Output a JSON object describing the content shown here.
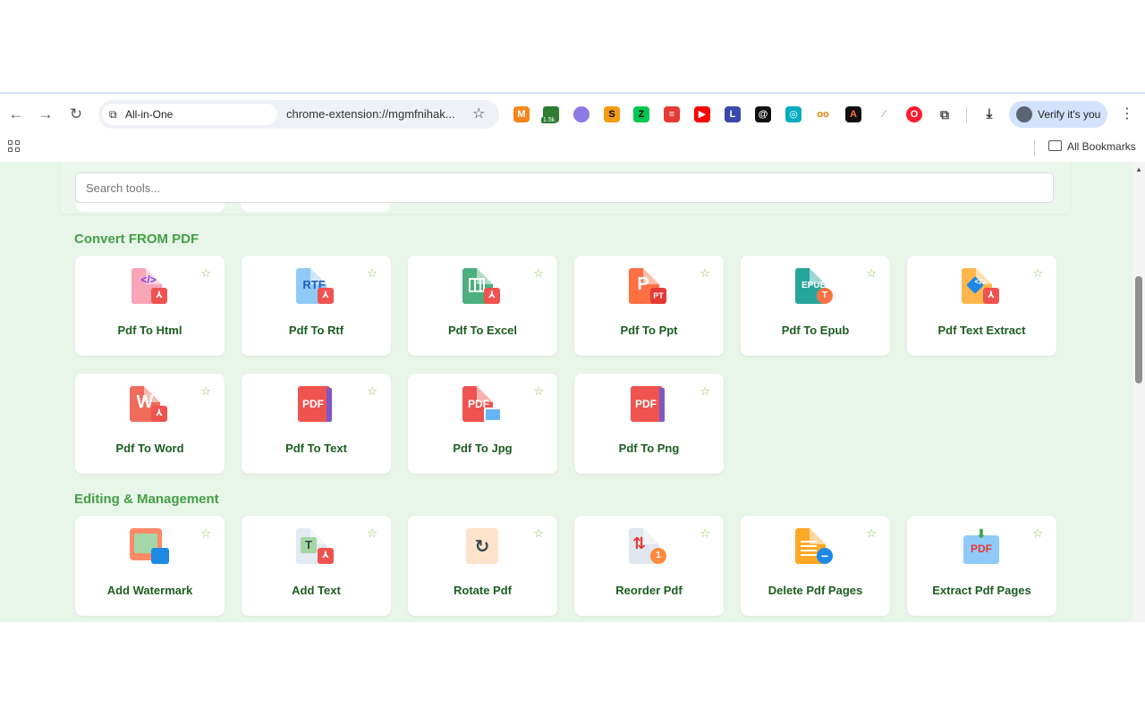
{
  "browser": {
    "tab_chip_label": "All-in-One",
    "url": "chrome-extension://mgmfnihak...",
    "extension_counter": "1.5k",
    "profile_label": "Verify it's you",
    "bookmarks_label": "All Bookmarks"
  },
  "search": {
    "placeholder": "Search tools..."
  },
  "sections": [
    {
      "title": "Convert FROM PDF",
      "tools": [
        {
          "label": "Pdf To Html",
          "icon": "pdf-to-html-icon"
        },
        {
          "label": "Pdf To Rtf",
          "icon": "pdf-to-rtf-icon",
          "icon_text": "RTF"
        },
        {
          "label": "Pdf To Excel",
          "icon": "pdf-to-excel-icon"
        },
        {
          "label": "Pdf To Ppt",
          "icon": "pdf-to-ppt-icon",
          "icon_text": "P",
          "badge": "PT"
        },
        {
          "label": "Pdf To Epub",
          "icon": "pdf-to-epub-icon",
          "icon_text": "EPUB",
          "badge": "T"
        },
        {
          "label": "Pdf Text Extract",
          "icon": "pdf-text-extract-icon"
        },
        {
          "label": "Pdf To Word",
          "icon": "pdf-to-word-icon",
          "icon_text": "W"
        },
        {
          "label": "Pdf To Text",
          "icon": "pdf-to-text-icon",
          "icon_text": "PDF"
        },
        {
          "label": "Pdf To Jpg",
          "icon": "pdf-to-jpg-icon",
          "icon_text": "PDF"
        },
        {
          "label": "Pdf To Png",
          "icon": "pdf-to-png-icon",
          "icon_text": "PDF"
        }
      ]
    },
    {
      "title": "Editing & Management",
      "tools": [
        {
          "label": "Add Watermark",
          "icon": "add-watermark-icon"
        },
        {
          "label": "Add Text",
          "icon": "add-text-icon",
          "icon_text": "T"
        },
        {
          "label": "Rotate Pdf",
          "icon": "rotate-pdf-icon"
        },
        {
          "label": "Reorder Pdf",
          "icon": "reorder-pdf-icon",
          "badge": "1"
        },
        {
          "label": "Delete Pdf Pages",
          "icon": "delete-pdf-pages-icon"
        },
        {
          "label": "Extract Pdf Pages",
          "icon": "extract-pdf-pages-icon",
          "icon_text": "PDF"
        }
      ]
    }
  ],
  "favorite_glyph": "☆",
  "colors": {
    "page_bg": "#e8f5e9",
    "section_title": "#43a047",
    "card_label": "#1b5e20",
    "favorite_star": "#8bc34a"
  }
}
